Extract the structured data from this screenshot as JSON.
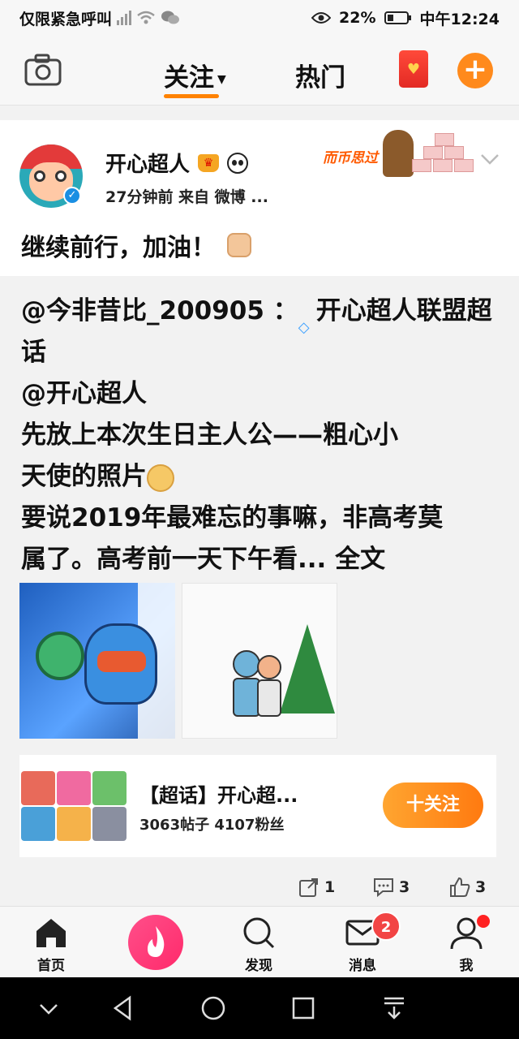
{
  "status_bar": {
    "carrier": "仅限紧急呼叫",
    "battery": "22%",
    "time": "中午12:24"
  },
  "top_nav": {
    "tab_follow": "关注",
    "tab_hot": "热门"
  },
  "post": {
    "username": "开心超人",
    "meta": "27分钟前  来自 微博 ...",
    "text": "继续前行，加油！",
    "banner_text": "而币思过"
  },
  "repost": {
    "lines": [
      "@今非昔比_200905 ：",
      "开心超人联盟超",
      "话",
      "@开心超人",
      "先放上本次生日主人公——粗心小",
      "天使的照片",
      "要说2019年最难忘的事嘛，非高考莫",
      "属了。高考前一天下午看... 全文"
    ]
  },
  "topic": {
    "title": "【超话】开心超...",
    "stats": "3063帖子 4107粉丝",
    "follow_label": "十关注"
  },
  "actions": {
    "repost_count": "1",
    "comment_count": "3",
    "like_count": "3"
  },
  "bottom_tabs": {
    "home": "首页",
    "discover": "发现",
    "messages": "消息",
    "messages_badge": "2",
    "me": "我"
  },
  "colors": {
    "accent_orange": "#ff8200",
    "badge_red": "#f24444",
    "verified_blue": "#1a8fe3"
  }
}
